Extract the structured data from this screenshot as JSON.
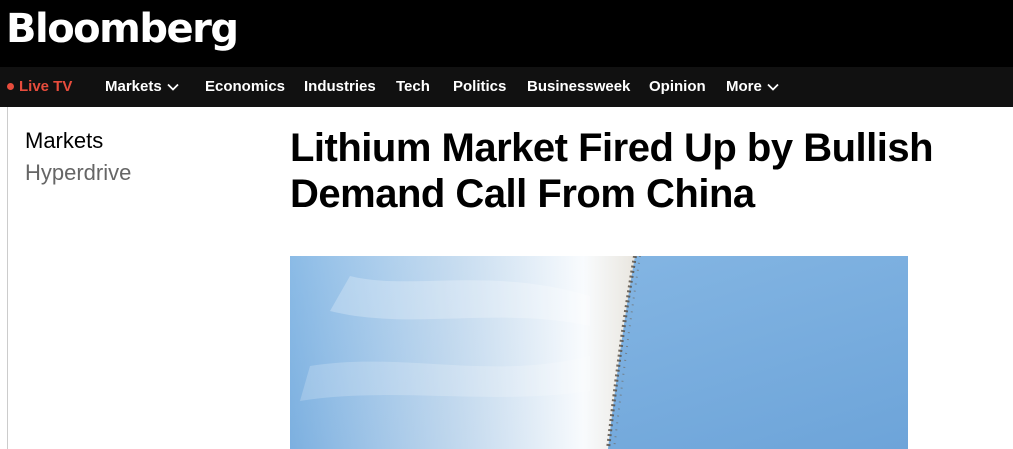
{
  "header": {
    "logo": "Bloomberg"
  },
  "nav": {
    "live_tv": "Live TV",
    "items": [
      {
        "label": "Markets",
        "has_dropdown": true
      },
      {
        "label": "Economics"
      },
      {
        "label": "Industries"
      },
      {
        "label": "Tech"
      },
      {
        "label": "Politics"
      },
      {
        "label": "Businessweek"
      },
      {
        "label": "Opinion"
      },
      {
        "label": "More",
        "has_dropdown": true
      }
    ]
  },
  "article": {
    "section": "Markets",
    "subsection": "Hyperdrive",
    "headline": "Lithium Market Fired Up by Bullish Demand Call From China"
  },
  "colors": {
    "topbar": "#000000",
    "navbar": "#111111",
    "live_accent": "#e74c3c",
    "sky": "#79aee0"
  }
}
